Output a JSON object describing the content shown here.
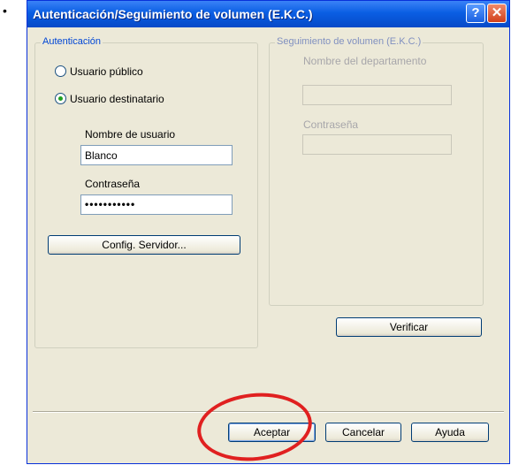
{
  "page": {
    "bullet": "•"
  },
  "window": {
    "title": "Autenticación/Seguimiento de volumen (E.K.C.)",
    "help_label": "?",
    "close_label": "✕"
  },
  "auth_group": {
    "legend": "Autenticación",
    "radio_public": "Usuario público",
    "radio_recipient": "Usuario destinatario",
    "selected": "Usuario destinatario",
    "username_label": "Nombre de usuario",
    "username_value": "Blanco",
    "password_label": "Contraseña",
    "password_value": "•••••••••••",
    "server_button": "Config. Servidor..."
  },
  "tracking_group": {
    "legend": "Seguimiento de volumen (E.K.C.)",
    "department_label": "Nombre del departamento",
    "department_value": "",
    "password_label": "Contraseña",
    "password_value": "",
    "verify_button": "Verificar"
  },
  "footer": {
    "accept_button": "Aceptar",
    "cancel_button": "Cancelar",
    "help_button": "Ayuda"
  },
  "colors": {
    "titlebar": "#0a5ee3",
    "legend_text": "#0046d5",
    "highlight_ring": "#e02020"
  }
}
